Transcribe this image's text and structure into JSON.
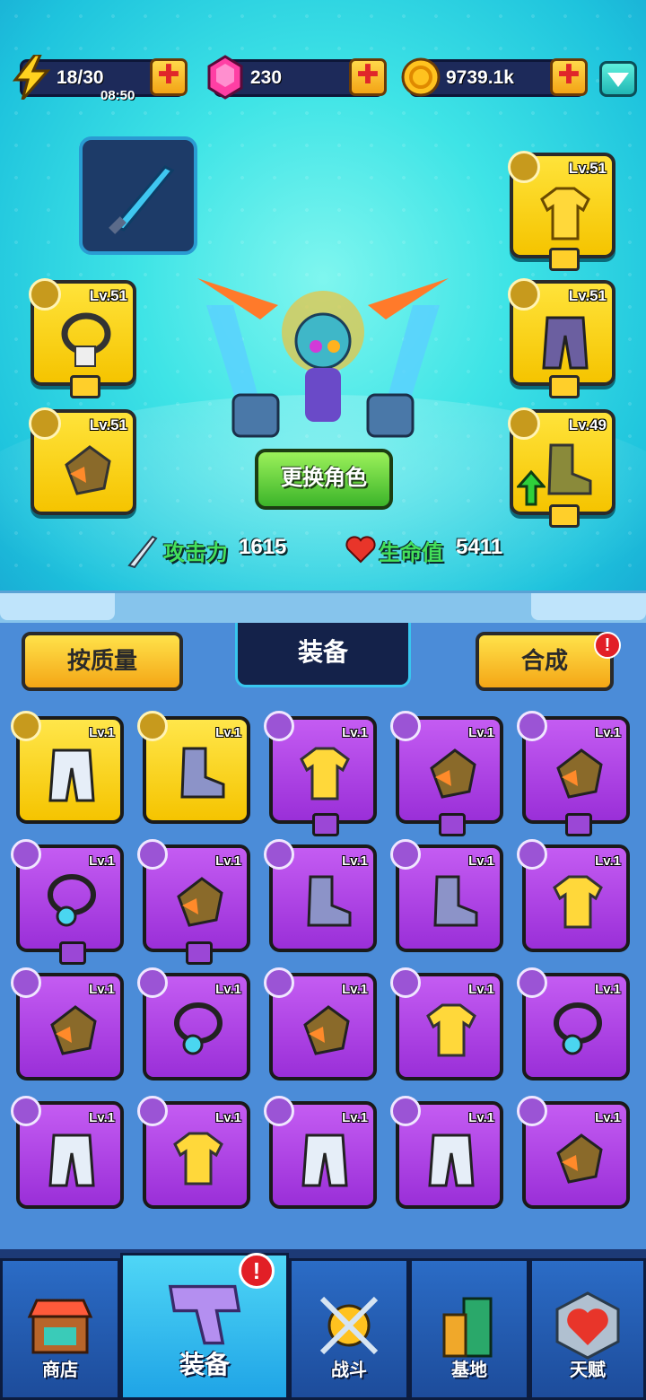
{
  "resources": {
    "energy": {
      "value": "18/30",
      "timer": "08:50"
    },
    "gems": {
      "value": "230"
    },
    "gold": {
      "value": "9739.1k"
    },
    "plus_label": "✚"
  },
  "hero_slots": [
    {
      "slot": "necklace",
      "level": "Lv.51",
      "icon": "necklace-icon"
    },
    {
      "slot": "glove",
      "level": "Lv.51",
      "icon": "glove-icon"
    },
    {
      "slot": "shirt",
      "level": "Lv.51",
      "icon": "shirt-icon"
    },
    {
      "slot": "pants",
      "level": "Lv.51",
      "icon": "pants-icon"
    },
    {
      "slot": "boots",
      "level": "Lv.49",
      "icon": "boots-icon",
      "upgrade_available": true
    }
  ],
  "change_role_label": "更换角色",
  "stats": {
    "attack_label": "攻击力",
    "attack_value": "1615",
    "hp_label": "生命值",
    "hp_value": "5411"
  },
  "inventory": {
    "sort_label": "按质量",
    "tab_label": "装备",
    "craft_label": "合成",
    "alert": "!",
    "items": [
      {
        "level": "Lv.1",
        "rarity": "gold",
        "type": "pants-icon",
        "art": "white-shorts"
      },
      {
        "level": "Lv.1",
        "rarity": "gold",
        "type": "boots-icon",
        "art": "silver-boots"
      },
      {
        "level": "Lv.1",
        "rarity": "purple",
        "type": "shirt-icon",
        "art": "armor-vest",
        "tab": true
      },
      {
        "level": "Lv.1",
        "rarity": "purple",
        "type": "glove-icon",
        "art": "rock-glove",
        "tab": true
      },
      {
        "level": "Lv.1",
        "rarity": "purple",
        "type": "glove-icon",
        "art": "crystal-glove",
        "tab": true
      },
      {
        "level": "Lv.1",
        "rarity": "purple",
        "type": "necklace-icon",
        "art": "gem-necklace",
        "tab": true
      },
      {
        "level": "Lv.1",
        "rarity": "purple",
        "type": "glove-icon",
        "art": "yellow-glove",
        "tab": true
      },
      {
        "level": "Lv.1",
        "rarity": "purple",
        "type": "boots-icon",
        "art": "silver-boots"
      },
      {
        "level": "Lv.1",
        "rarity": "purple",
        "type": "boots-icon",
        "art": "green-boots"
      },
      {
        "level": "Lv.1",
        "rarity": "purple",
        "type": "shirt-icon",
        "art": "hawaii-shirt"
      },
      {
        "level": "Lv.1",
        "rarity": "purple",
        "type": "glove-icon",
        "art": "rock-glove"
      },
      {
        "level": "Lv.1",
        "rarity": "purple",
        "type": "necklace-icon",
        "art": "blue-necklace"
      },
      {
        "level": "Lv.1",
        "rarity": "purple",
        "type": "glove-icon",
        "art": "white-glove"
      },
      {
        "level": "Lv.1",
        "rarity": "purple",
        "type": "shirt-icon",
        "art": "crystal-armor"
      },
      {
        "level": "Lv.1",
        "rarity": "purple",
        "type": "necklace-icon",
        "art": "gem-necklace"
      },
      {
        "level": "Lv.1",
        "rarity": "purple",
        "type": "pants-icon",
        "art": "crystal-pants"
      },
      {
        "level": "Lv.1",
        "rarity": "purple",
        "type": "shirt-icon",
        "art": "crystal-armor"
      },
      {
        "level": "Lv.1",
        "rarity": "purple",
        "type": "pants-icon",
        "art": "yellow-shorts"
      },
      {
        "level": "Lv.1",
        "rarity": "purple",
        "type": "pants-icon",
        "art": "yellow-shorts"
      },
      {
        "level": "Lv.1",
        "rarity": "purple",
        "type": "glove-icon",
        "art": "crystal-glove"
      }
    ]
  },
  "nav": [
    {
      "label": "商店",
      "icon": "shop-icon"
    },
    {
      "label": "装备",
      "icon": "equipment-icon",
      "active": true
    },
    {
      "label": "战斗",
      "icon": "battle-icon"
    },
    {
      "label": "基地",
      "icon": "base-icon"
    },
    {
      "label": "天赋",
      "icon": "talent-icon"
    }
  ],
  "colors": {
    "gold": "#f5c400",
    "purple": "#9a2fd8",
    "accent_cyan": "#3fe4e6",
    "alert_red": "#e21f26",
    "green": "#44e05a"
  }
}
